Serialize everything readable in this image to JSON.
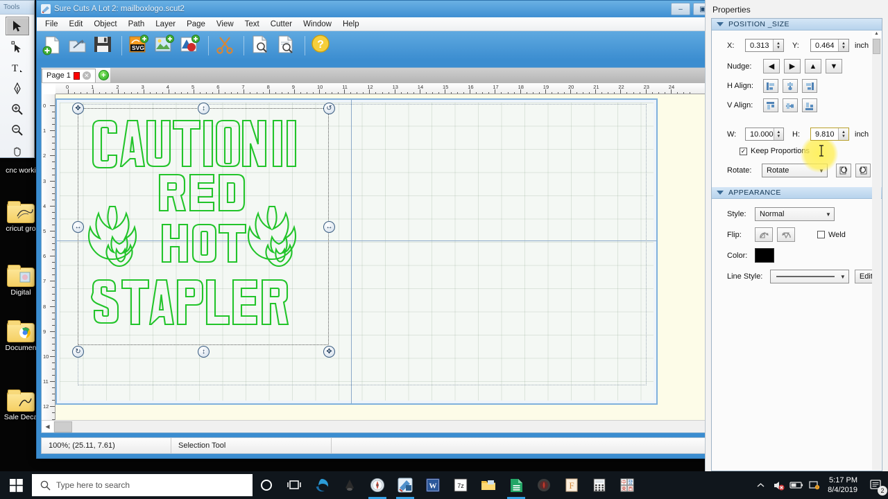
{
  "desktop": {
    "icons": [
      {
        "label": "cnc worki",
        "name": "desktop-icon-cnc-working"
      },
      {
        "label": "cricut gro",
        "name": "desktop-icon-cricut-group"
      },
      {
        "label": "Digital",
        "name": "desktop-icon-digital"
      },
      {
        "label": "Documen",
        "name": "desktop-icon-documents"
      },
      {
        "label": "Sale Deca",
        "name": "desktop-icon-sale-decals"
      }
    ]
  },
  "tools_palette": {
    "title": "Tools",
    "tools": [
      {
        "name": "selection-tool",
        "icon": "arrow-cursor-icon",
        "active": true
      },
      {
        "name": "node-edit-tool",
        "icon": "node-edit-icon",
        "active": false
      },
      {
        "name": "text-tool",
        "icon": "text-icon",
        "active": false
      },
      {
        "name": "pen-tool",
        "icon": "pen-icon",
        "active": false
      },
      {
        "name": "zoom-in-tool",
        "icon": "zoom-in-icon",
        "active": false
      },
      {
        "name": "zoom-out-tool",
        "icon": "zoom-out-icon",
        "active": false
      },
      {
        "name": "pan-tool",
        "icon": "hand-icon",
        "active": false
      }
    ]
  },
  "window": {
    "title": "Sure Cuts A Lot 2: mailboxlogo.scut2",
    "controls": {
      "minimize": "–",
      "restore": "▣",
      "close": "✕"
    }
  },
  "menubar": {
    "items": [
      "File",
      "Edit",
      "Object",
      "Path",
      "Layer",
      "Page",
      "View",
      "Text",
      "Cutter",
      "Window",
      "Help"
    ]
  },
  "toolbar": {
    "buttons": [
      {
        "name": "new-document-button",
        "icon": "new-page-icon"
      },
      {
        "name": "open-document-button",
        "icon": "open-folder-icon"
      },
      {
        "name": "save-document-button",
        "icon": "floppy-save-icon"
      },
      {
        "name": "import-svg-button",
        "icon": "svg-import-icon"
      },
      {
        "name": "import-image-button",
        "icon": "image-import-icon"
      },
      {
        "name": "import-shape-button",
        "icon": "shape-import-icon"
      },
      {
        "name": "cut-button",
        "icon": "scissors-icon"
      },
      {
        "name": "preview-button",
        "icon": "page-preview-icon"
      },
      {
        "name": "print-preview-button",
        "icon": "print-preview-icon"
      },
      {
        "name": "help-button",
        "icon": "help-question-icon"
      }
    ]
  },
  "tabstrip": {
    "page_label": "Page 1",
    "swatch_color": "#ff0000",
    "close_glyph": "✕",
    "add_glyph": "+"
  },
  "rulers": {
    "unit": "inch",
    "horizontal_ticks": [
      0,
      1,
      2,
      3,
      4,
      5,
      6,
      7,
      8,
      9,
      10,
      11,
      12,
      13,
      14,
      15,
      16,
      17,
      18,
      19,
      20,
      21,
      22,
      23,
      24
    ],
    "vertical_ticks": [
      0,
      1,
      2,
      3,
      4,
      5,
      6,
      7,
      8,
      9,
      10,
      11,
      12
    ]
  },
  "artwork": {
    "stroke_color": "#22c42a",
    "lines": [
      "CAUTION",
      "RED",
      "HOT",
      "STAPLER"
    ],
    "decorations": [
      "flame-left",
      "flame-right"
    ],
    "handles": [
      {
        "name": "handle-top-left",
        "glyph": "✥"
      },
      {
        "name": "handle-top-center",
        "glyph": "↕"
      },
      {
        "name": "handle-top-right",
        "glyph": "↺"
      },
      {
        "name": "handle-middle-left",
        "glyph": "↔"
      },
      {
        "name": "handle-middle-right",
        "glyph": "↔"
      },
      {
        "name": "handle-bottom-left",
        "glyph": "↻"
      },
      {
        "name": "handle-bottom-center",
        "glyph": "↕"
      },
      {
        "name": "handle-bottom-right",
        "glyph": "✥"
      }
    ]
  },
  "statusbar": {
    "zoom_and_coords": "100%; (25.11, 7.61)",
    "active_tool": "Selection Tool"
  },
  "properties": {
    "title": "Properties",
    "position_size": {
      "header": "POSITION _SIZE",
      "x_label": "X:",
      "x_value": "0.313",
      "y_label": "Y:",
      "y_value": "0.464",
      "unit": "inch",
      "nudge_label": "Nudge:",
      "nudge_buttons": [
        {
          "name": "nudge-left-button",
          "glyph": "◀"
        },
        {
          "name": "nudge-right-button",
          "glyph": "▶"
        },
        {
          "name": "nudge-up-button",
          "glyph": "▲"
        },
        {
          "name": "nudge-down-button",
          "glyph": "▼"
        }
      ],
      "h_align_label": "H Align:",
      "h_align_buttons": [
        "align-left-button",
        "align-center-button",
        "align-right-button"
      ],
      "v_align_label": "V Align:",
      "v_align_buttons": [
        "align-top-button",
        "align-middle-button",
        "align-bottom-button"
      ],
      "w_label": "W:",
      "w_value": "10.000",
      "h_label": "H:",
      "h_value": "9.810",
      "size_unit": "inch",
      "keep_proportions_label": "Keep Proportions",
      "keep_proportions_checked": true,
      "rotate_label": "Rotate:",
      "rotate_value": "Rotate",
      "rotate_buttons": [
        "rotate-ccw-button",
        "rotate-cw-button"
      ]
    },
    "appearance": {
      "header": "APPEARANCE",
      "style_label": "Style:",
      "style_value": "Normal",
      "flip_label": "Flip:",
      "flip_buttons": [
        "flip-horizontal-button",
        "flip-vertical-button"
      ],
      "weld_label": "Weld",
      "weld_checked": false,
      "color_label": "Color:",
      "color_value": "#000000",
      "line_style_label": "Line Style:",
      "line_style_value": "solid",
      "edit_label": "Edit"
    }
  },
  "taskbar": {
    "search_placeholder": "Type here to search",
    "start_icon": "windows-logo-icon",
    "search_icon": "search-icon",
    "buttons": [
      {
        "name": "taskbar-cortana",
        "icon": "cortana-circle-icon"
      },
      {
        "name": "taskbar-task-view",
        "icon": "task-view-icon"
      },
      {
        "name": "taskbar-edge",
        "icon": "edge-browser-icon"
      },
      {
        "name": "taskbar-inkscape",
        "icon": "inkscape-icon"
      },
      {
        "name": "taskbar-clock-app",
        "icon": "compass-icon",
        "active": true
      },
      {
        "name": "taskbar-scal",
        "icon": "sure-cuts-a-lot-icon",
        "active": true
      },
      {
        "name": "taskbar-word",
        "icon": "word-icon"
      },
      {
        "name": "taskbar-7zip",
        "icon": "seven-zip-icon"
      },
      {
        "name": "taskbar-explorer",
        "icon": "file-explorer-icon"
      },
      {
        "name": "taskbar-sheets",
        "icon": "sheets-icon",
        "active": true
      },
      {
        "name": "taskbar-silhouette",
        "icon": "silhouette-icon"
      },
      {
        "name": "taskbar-fontforge",
        "icon": "font-icon"
      },
      {
        "name": "taskbar-calculator",
        "icon": "calculator-icon"
      },
      {
        "name": "taskbar-mahjong",
        "icon": "mahjong-icon"
      }
    ],
    "tray": [
      {
        "name": "tray-expand",
        "icon": "chevron-up-icon"
      },
      {
        "name": "tray-volume",
        "icon": "volume-muted-icon"
      },
      {
        "name": "tray-battery",
        "icon": "battery-icon"
      },
      {
        "name": "tray-network",
        "icon": "network-icon"
      }
    ],
    "clock_time": "5:17 PM",
    "clock_date": "8/4/2019",
    "notification_count": "2"
  }
}
